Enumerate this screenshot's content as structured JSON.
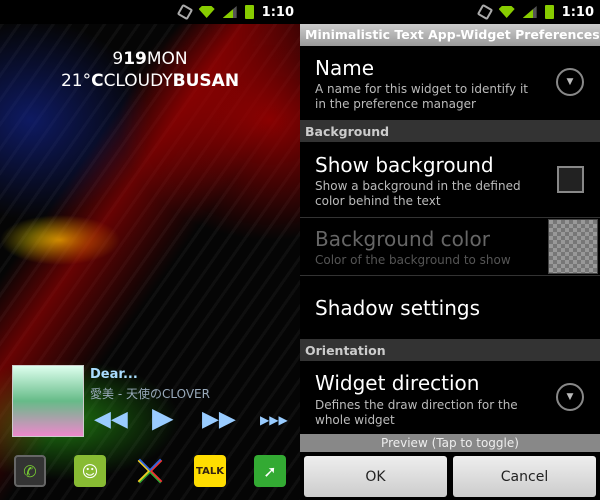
{
  "status": {
    "time": "1:10"
  },
  "home": {
    "widget": {
      "line1_a": "9",
      "line1_b": "19",
      "line1_c": "MON",
      "line2_a": "21°",
      "line2_b": "C",
      "line2_c": "CLOUDY",
      "line2_d": "BUSAN"
    },
    "music": {
      "song": "Dear...",
      "artist": "愛美 - 天使のCLOVER"
    },
    "dock": [
      "phone-icon",
      "messaging-icon",
      "launcher-icon",
      "kakaotalk-icon",
      "dolphin-browser-icon"
    ],
    "dock_talk_label": "TALK"
  },
  "prefs": {
    "title": "Minimalistic Text App-Widget Preferences",
    "name": {
      "title": "Name",
      "summary": "A name for this widget to identify it in the preference manager"
    },
    "background_header": "Background",
    "show_background": {
      "title": "Show background",
      "summary": "Show a background in the defined color behind the text",
      "checked": false
    },
    "background_color": {
      "title": "Background color",
      "summary": "Color of the background to show",
      "enabled": false
    },
    "shadow": {
      "title": "Shadow settings"
    },
    "orientation_header": "Orientation",
    "direction": {
      "title": "Widget direction",
      "summary": "Defines the draw direction for the whole widget"
    },
    "preview": "Preview (Tap to toggle)",
    "ok": "OK",
    "cancel": "Cancel"
  }
}
